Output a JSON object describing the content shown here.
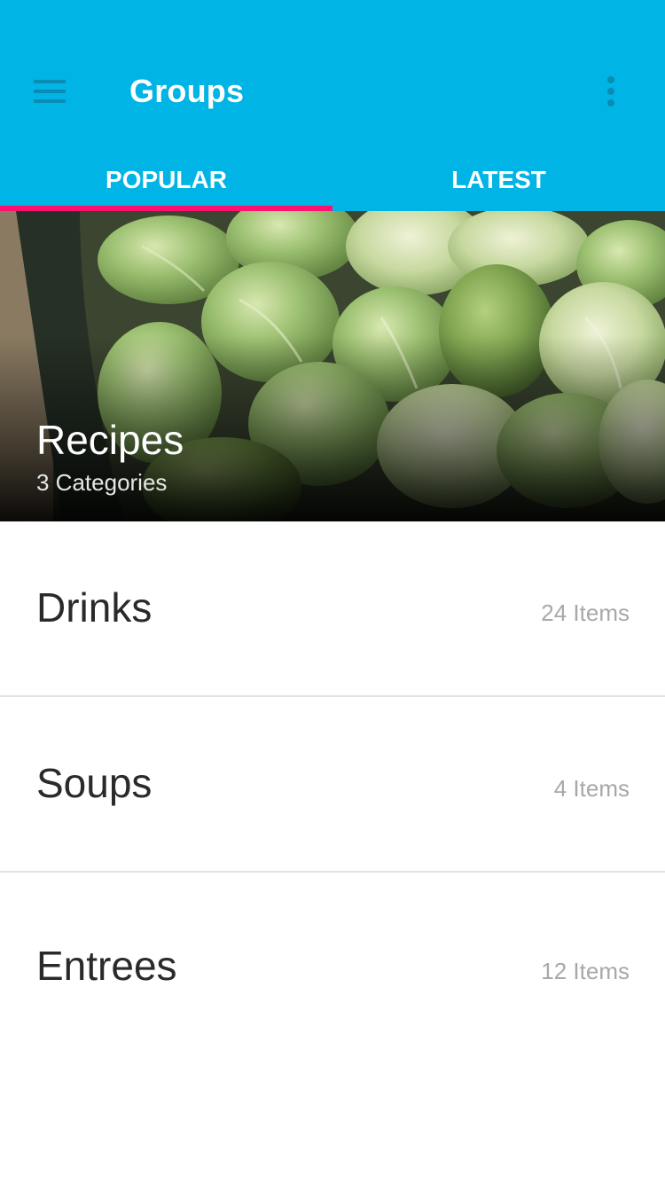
{
  "appbar": {
    "title": "Groups",
    "menu_icon": "hamburger-menu-icon",
    "more_icon": "more-vertical-icon",
    "background_color": "#00b4e5",
    "icon_color": "#0a8bb3"
  },
  "tabs": [
    {
      "label": "POPULAR",
      "active": true
    },
    {
      "label": "LATEST",
      "active": false
    }
  ],
  "tab_indicator_color": "#ff0f6e",
  "hero": {
    "title": "Recipes",
    "subtitle": "3 Categories"
  },
  "groups": [
    {
      "name": "Drinks",
      "count": "24 Items"
    },
    {
      "name": "Soups",
      "count": "4 Items"
    },
    {
      "name": "Entrees",
      "count": "12 Items"
    }
  ]
}
